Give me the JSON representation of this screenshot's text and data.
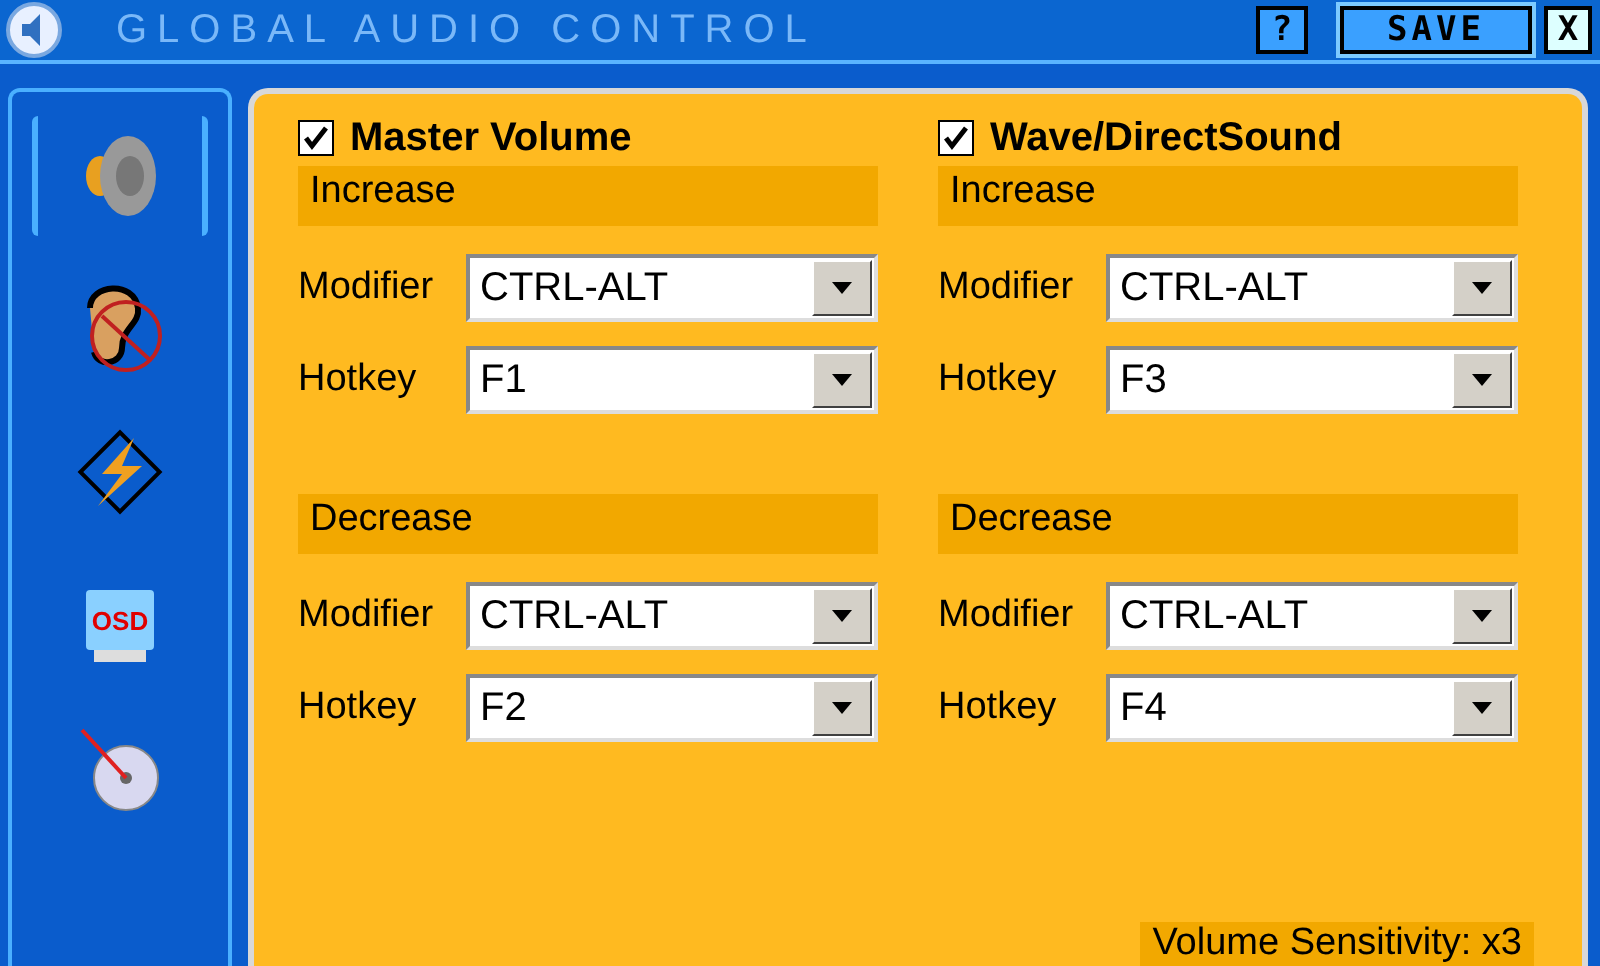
{
  "window": {
    "title": "GLOBAL AUDIO CONTROL",
    "help": "?",
    "save": "SAVE",
    "close": "X"
  },
  "sidebar": {
    "items": [
      {
        "kind": "speaker",
        "selected": true
      },
      {
        "kind": "ear",
        "selected": false
      },
      {
        "kind": "bolt",
        "selected": false
      },
      {
        "kind": "osd",
        "label": "OSD",
        "selected": false
      },
      {
        "kind": "disc",
        "selected": false
      }
    ]
  },
  "groups": [
    {
      "label": "Master Volume",
      "checked": true,
      "sections": [
        {
          "title": "Increase",
          "modifier_label": "Modifier",
          "modifier": "CTRL-ALT",
          "hotkey_label": "Hotkey",
          "hotkey": "F1"
        },
        {
          "title": "Decrease",
          "modifier_label": "Modifier",
          "modifier": "CTRL-ALT",
          "hotkey_label": "Hotkey",
          "hotkey": "F2"
        }
      ]
    },
    {
      "label": "Wave/DirectSound",
      "checked": true,
      "sections": [
        {
          "title": "Increase",
          "modifier_label": "Modifier",
          "modifier": "CTRL-ALT",
          "hotkey_label": "Hotkey",
          "hotkey": "F3"
        },
        {
          "title": "Decrease",
          "modifier_label": "Modifier",
          "modifier": "CTRL-ALT",
          "hotkey_label": "Hotkey",
          "hotkey": "F4"
        }
      ]
    }
  ],
  "sensitivity": "Volume Sensitivity: x3"
}
